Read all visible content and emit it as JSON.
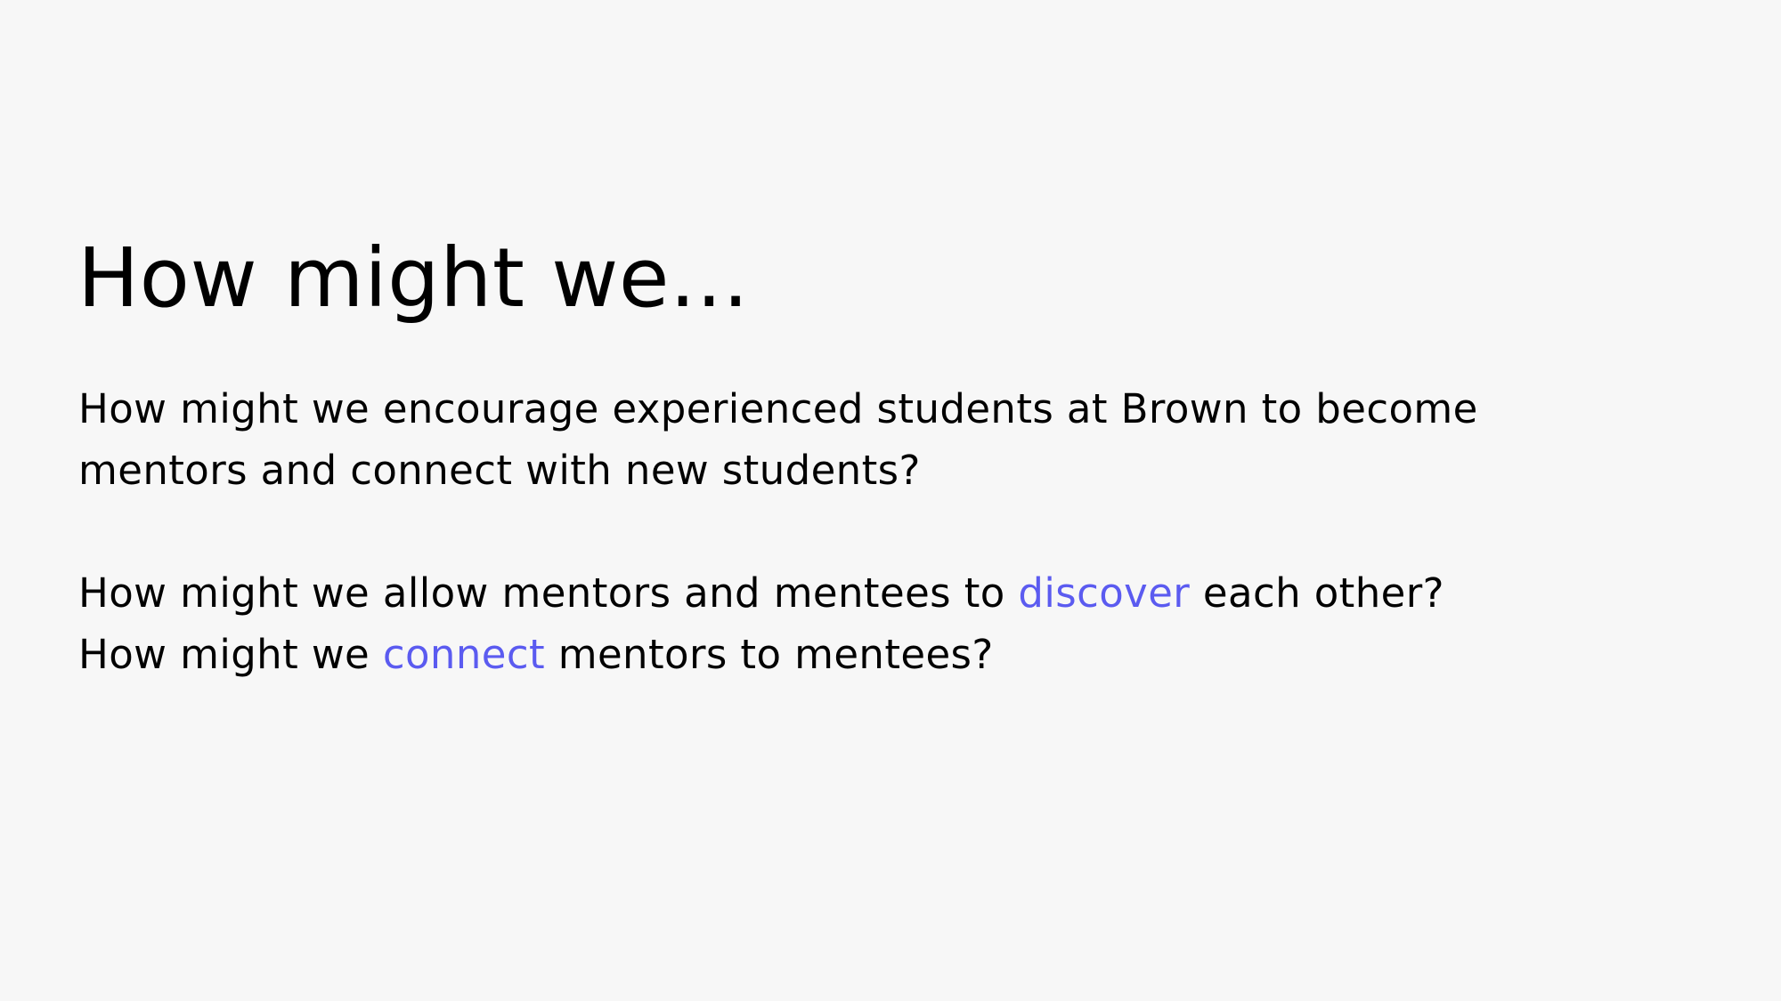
{
  "slide": {
    "title": "How might we...",
    "question_1": "How might we encourage experienced students at Brown to become mentors and connect with new students?",
    "question_2": {
      "before": "How might we allow mentors and mentees to ",
      "highlight": "discover",
      "after": " each other?"
    },
    "question_3": {
      "before": "How might we ",
      "highlight": "connect",
      "after": " mentors to mentees?"
    }
  },
  "colors": {
    "background": "#f7f7f7",
    "text": "#000000",
    "accent": "#5b5bf0"
  }
}
